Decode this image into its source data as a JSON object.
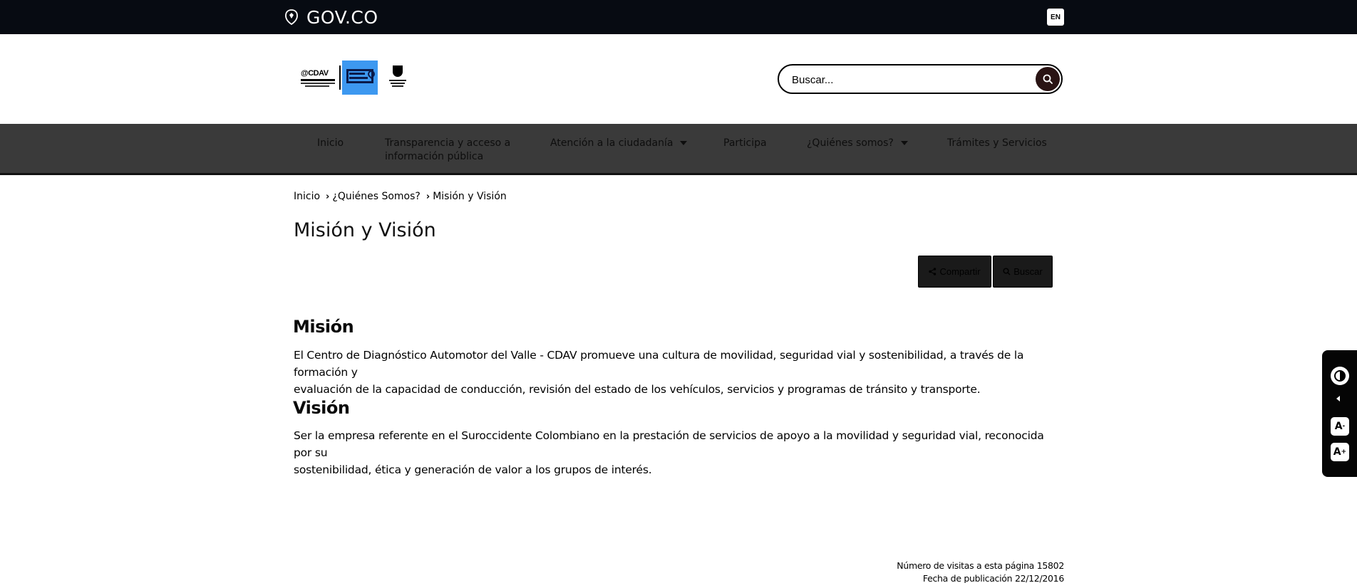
{
  "govbar": {
    "brand": "GOV.CO",
    "lang": "EN",
    "brand_icon": "colombia-shield-icon"
  },
  "header": {
    "logos": [
      "cdav-logo",
      "cdav-blue-logo",
      "gobernacion-logo"
    ],
    "search": {
      "placeholder": "Buscar...",
      "icon": "search-icon"
    }
  },
  "nav": {
    "items": [
      {
        "label": "Inicio"
      },
      {
        "label": "Transparencia y acceso a",
        "label2": "información pública"
      },
      {
        "label": "Atención a la ciudadanía",
        "dropdown": true
      },
      {
        "label": "Participa"
      },
      {
        "label": "¿Quiénes somos?",
        "dropdown": true
      },
      {
        "label": "Trámites y Servicios"
      }
    ]
  },
  "breadcrumb": [
    "Inicio",
    "¿Quiénes Somos?",
    "Misión y Visión"
  ],
  "page_title": "Misión y Visión",
  "actions": {
    "share": "Compartir",
    "search": "Buscar"
  },
  "sections": [
    {
      "title": "Misión",
      "lines": [
        "El Centro de Diagnóstico Automotor del Valle - CDAV promueve una cultura de movilidad, seguridad vial y sostenibilidad, a través de la formación y",
        "evaluación de la capacidad de conducción, revisión del estado de los vehículos, servicios y programas de tránsito y transporte."
      ]
    },
    {
      "title": "Visión",
      "lines": [
        "Ser la empresa referente en el Suroccidente Colombiano en la prestación de servicios de apoyo a la movilidad y seguridad vial, reconocida por su",
        "sostenibilidad, ética y generación de valor a los grupos de interés."
      ]
    }
  ],
  "footer": {
    "visits": "Número de visitas a esta página 15802",
    "published": "Fecha de publicación 22/12/2016"
  },
  "accessibility": {
    "contrast_icon": "contrast-icon",
    "collapse_icon": "chevron-left-icon",
    "decrease_label": "A",
    "decrease_sign": "-",
    "increase_label": "A",
    "increase_sign": "+"
  }
}
